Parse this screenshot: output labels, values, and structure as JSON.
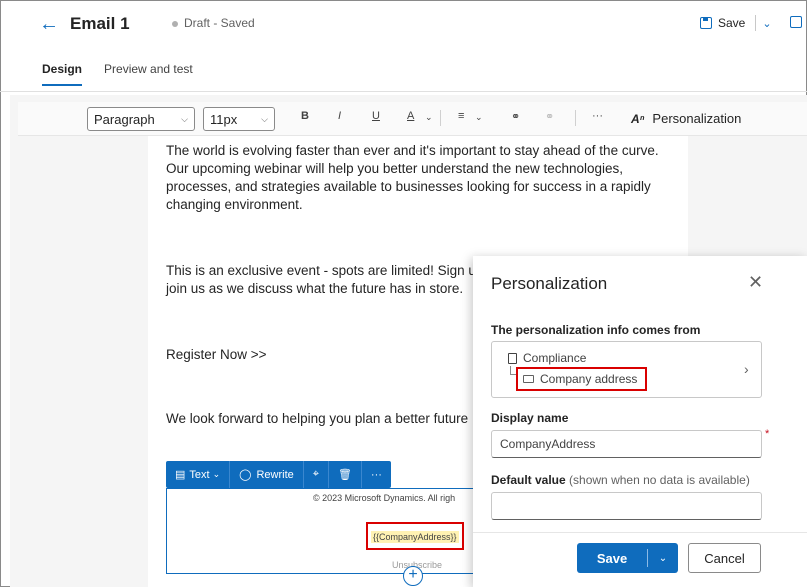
{
  "header": {
    "title": "Email 1",
    "status": "Draft - Saved",
    "save_label": "Save"
  },
  "tabs": [
    {
      "label": "Design",
      "active": true
    },
    {
      "label": "Preview and test",
      "active": false
    }
  ],
  "toolbar": {
    "style_select": "Paragraph",
    "size_select": "11px",
    "bold": "B",
    "italic": "I",
    "underline": "U",
    "font_color": "A",
    "more": "···",
    "personalization_label": "Personalization"
  },
  "email": {
    "paragraphs": [
      "The world is evolving faster than ever and it's important to stay ahead of the curve.",
      "Our upcoming webinar will help you better understand the new technologies,",
      "processes, and strategies available to businesses looking for success in a rapidly",
      "changing environment."
    ],
    "exclusive_1": "This is an exclusive event - spots are limited! Sign up",
    "exclusive_2": "join us as we discuss what the future has in store.",
    "register": "Register Now >>",
    "closing": "We look forward to helping you plan a better future",
    "footer": {
      "copyright": "© 2023 Microsoft Dynamics. All righ",
      "token": "{{CompanyAddress}}",
      "unsubscribe": "Unsubscribe"
    }
  },
  "block_toolbar": {
    "text_label": "Text",
    "rewrite_label": "Rewrite",
    "more": "···"
  },
  "panel": {
    "title": "Personalization",
    "source_label": "The personalization info comes from",
    "source_parent": "Compliance",
    "source_child": "Company address",
    "display_name_label": "Display name",
    "display_name_value": "CompanyAddress",
    "default_value_label": "Default value",
    "default_value_hint": "(shown when no data is available)",
    "default_value_value": "",
    "save_label": "Save",
    "cancel_label": "Cancel"
  },
  "colors": {
    "accent": "#0f6cbd",
    "highlight_box": "#d90000",
    "token_bg": "#fff2b3"
  }
}
